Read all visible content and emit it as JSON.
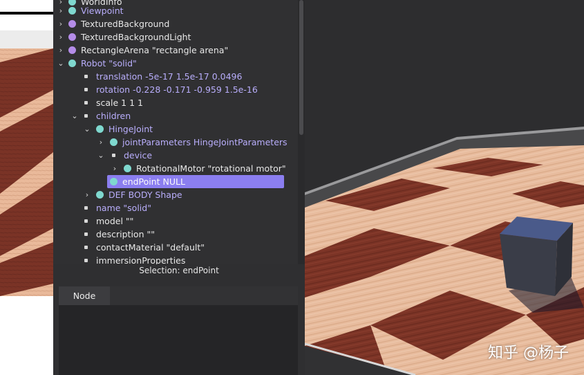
{
  "tree": {
    "rows": [
      {
        "label": "WorldInfo"
      },
      {
        "label": "Viewpoint"
      },
      {
        "label": "TexturedBackground"
      },
      {
        "label": "TexturedBackgroundLight"
      },
      {
        "label": "RectangleArena \"rectangle arena\""
      },
      {
        "label": "Robot \"solid\""
      },
      {
        "label": "translation -5e-17 1.5e-17 0.0496"
      },
      {
        "label": "rotation -0.228 -0.171 -0.959 1.5e-16"
      },
      {
        "label": "scale 1 1 1"
      },
      {
        "label": "children"
      },
      {
        "label": "HingeJoint"
      },
      {
        "label": "jointParameters HingeJointParameters"
      },
      {
        "label": "device"
      },
      {
        "label": "RotationalMotor \"rotational motor\""
      },
      {
        "label": "endPoint NULL"
      },
      {
        "label": "DEF BODY Shape"
      },
      {
        "label": "name \"solid\""
      },
      {
        "label": "model \"\""
      },
      {
        "label": "description \"\""
      },
      {
        "label": "contactMaterial \"default\""
      },
      {
        "label": "immersionProperties"
      }
    ]
  },
  "selection_text": "Selection: endPoint",
  "tabs": {
    "node": "Node"
  },
  "watermark": "知乎 @杨子",
  "colors": {
    "selected_row": "#8b7ef0",
    "proto_node_dot": "#b48ce8",
    "node_dot": "#7fd8cf",
    "modified_field_text": "#b9aefc"
  }
}
